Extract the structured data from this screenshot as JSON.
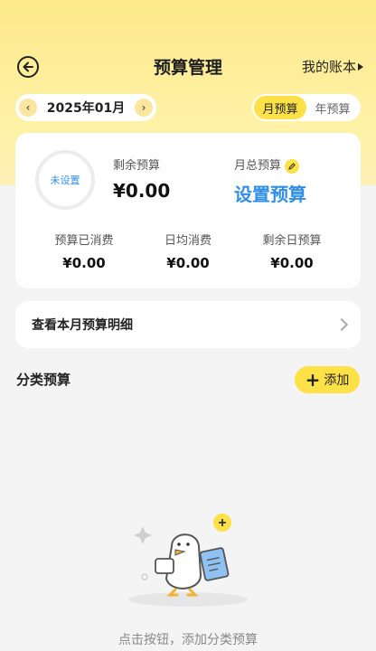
{
  "header": {
    "title": "预算管理",
    "ledger_link": "我的账本"
  },
  "month_picker": {
    "value": "2025年01月",
    "prev_symbol": "‹",
    "next_symbol": "›"
  },
  "period_toggle": {
    "tabs": [
      {
        "label": "月预算",
        "active": true
      },
      {
        "label": "年预算",
        "active": false
      }
    ]
  },
  "summary": {
    "ring_status": "未设置",
    "remaining_label": "剩余预算",
    "remaining_value": "¥0.00",
    "total_label": "月总预算",
    "total_value": "设置预算",
    "stats": [
      {
        "label": "预算已消费",
        "value": "¥0.00"
      },
      {
        "label": "日均消费",
        "value": "¥0.00"
      },
      {
        "label": "剩余日预算",
        "value": "¥0.00"
      }
    ]
  },
  "detail_row": {
    "label": "查看本月预算明细"
  },
  "category": {
    "title": "分类预算",
    "add_label": "添加",
    "empty_text": "点击按钮，添加分类预算"
  },
  "colors": {
    "accent_yellow": "#fde146",
    "link_blue": "#2f8fe6"
  }
}
